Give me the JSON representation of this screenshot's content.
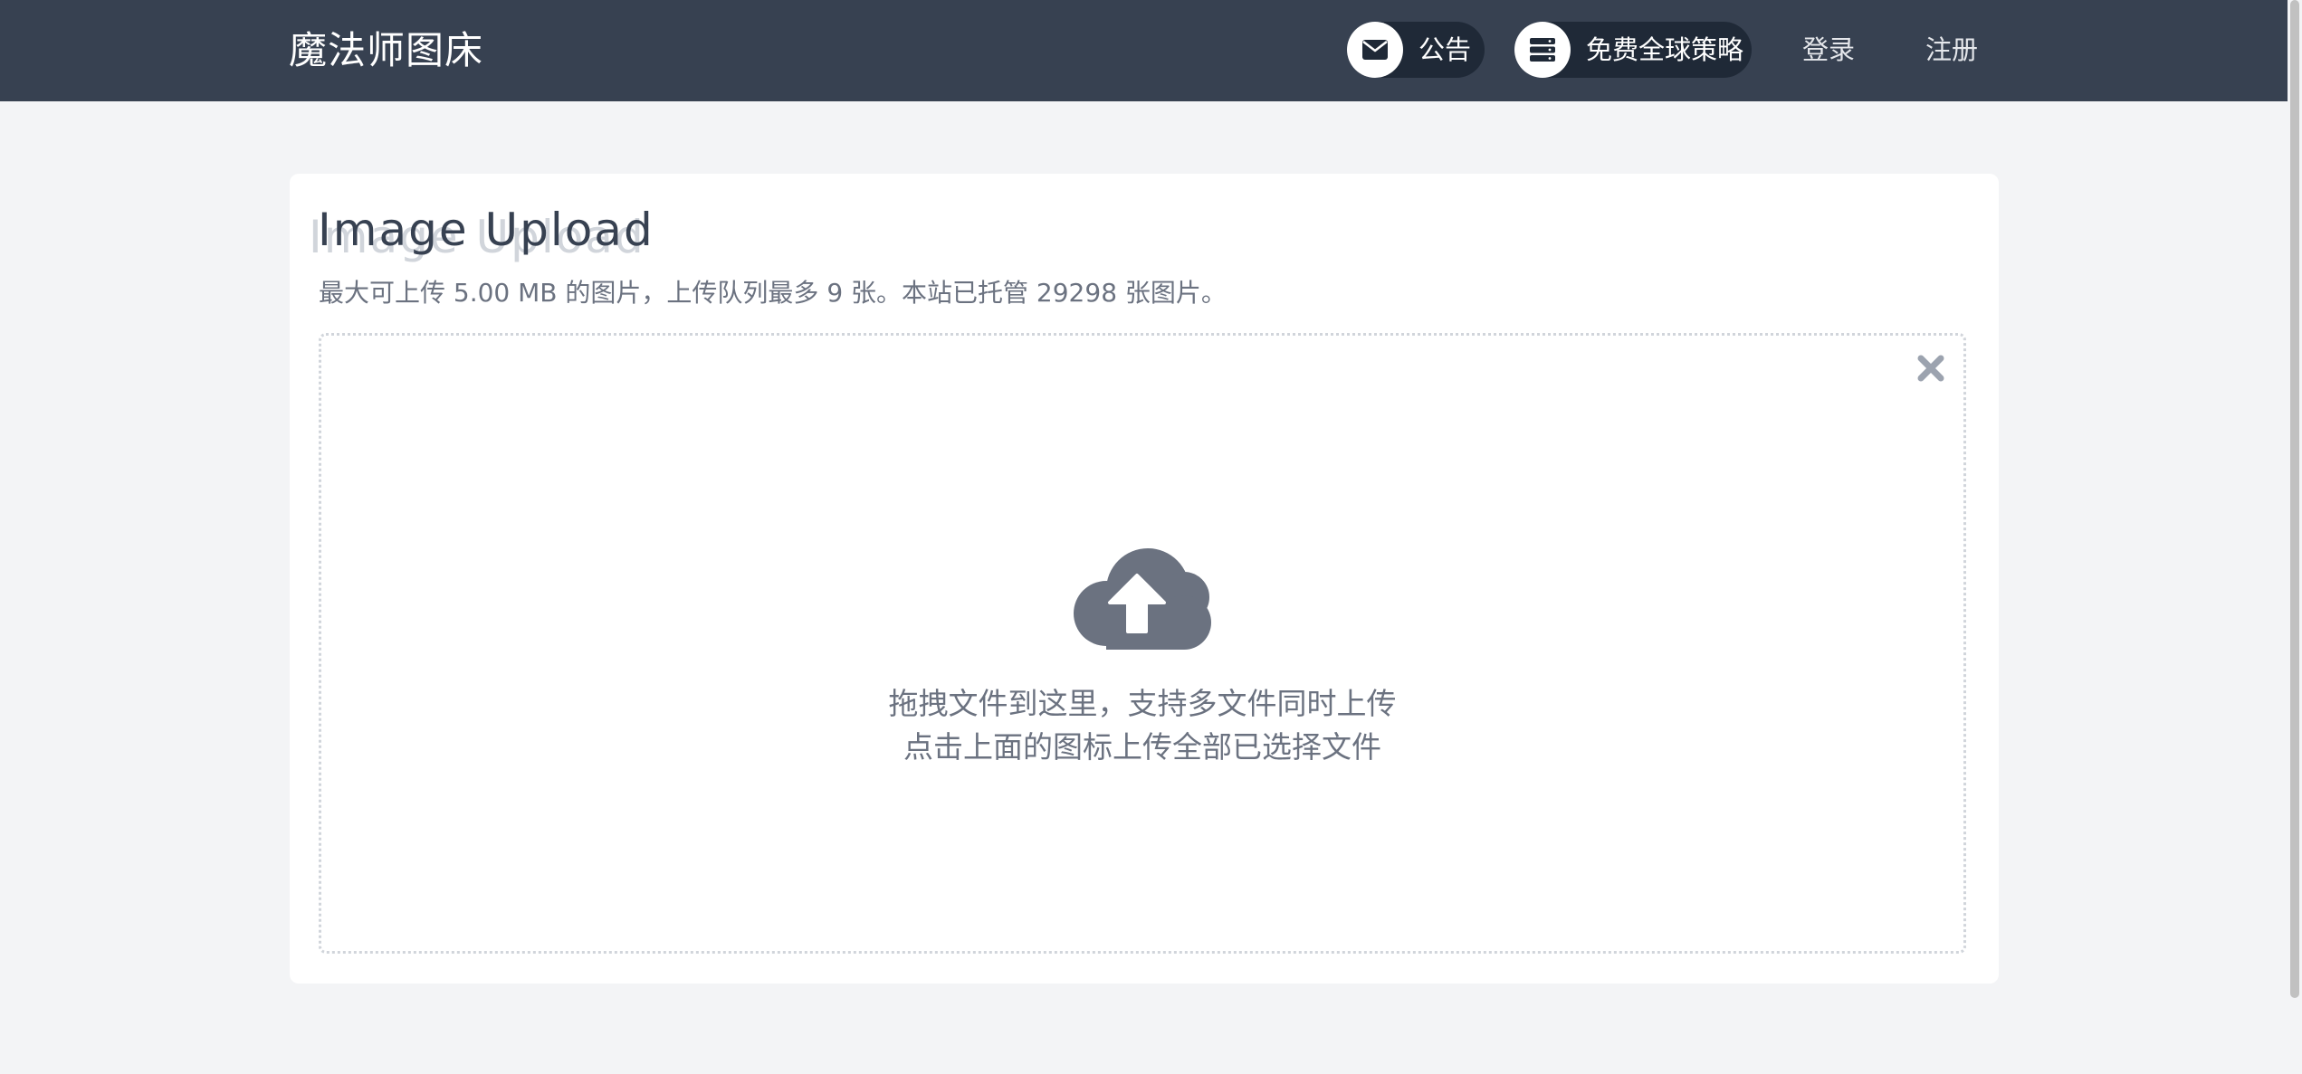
{
  "header": {
    "brand": "魔法师图床",
    "notice_label": "公告",
    "notice_icon": "envelope-icon",
    "strategy_label": "免费全球策略",
    "strategy_icon": "server-icon",
    "login_label": "登录",
    "register_label": "注册"
  },
  "upload": {
    "title": "Image Upload",
    "subtitle": "最大可上传 5.00 MB 的图片，上传队列最多 9 张。本站已托管 29298 张图片。",
    "drop_line_1": "拖拽文件到这里，支持多文件同时上传",
    "drop_line_2": "点击上面的图标上传全部已选择文件",
    "upload_icon": "cloud-upload-icon",
    "clear_icon": "close-icon"
  },
  "colors": {
    "navbar": "#374151",
    "pill": "#1f2937",
    "page_background": "#f3f4f6",
    "icon_gray": "#6b7280"
  }
}
